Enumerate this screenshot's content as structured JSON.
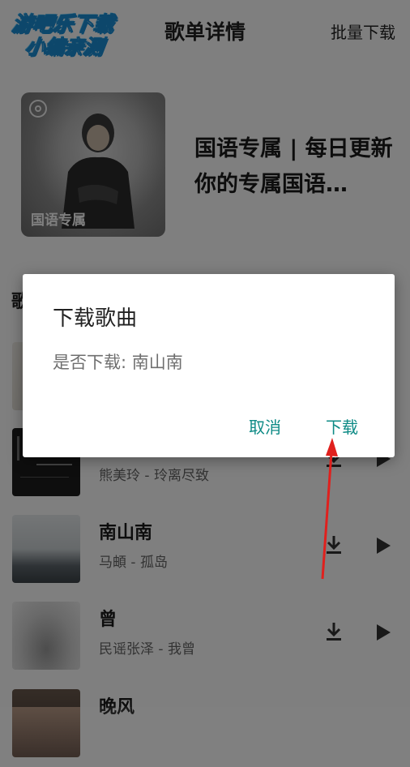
{
  "logo": {
    "line1": "游吧乐下载",
    "line2": "小编亲测"
  },
  "header": {
    "title": "歌单详情",
    "batch_download": "批量下载"
  },
  "playlist": {
    "cover_label": "国语专属",
    "title": "国语专属 | 每日更新 你的专属国语…"
  },
  "section": {
    "head": "歌"
  },
  "songs": [
    {
      "title": "",
      "subtitle": ""
    },
    {
      "title": "",
      "subtitle": "熊美玲 - 玲离尽致"
    },
    {
      "title": "南山南",
      "subtitle": "马頔 - 孤岛"
    },
    {
      "title": "曾",
      "subtitle": "民谣张泽 - 我曾"
    },
    {
      "title": "晚风",
      "subtitle": ""
    }
  ],
  "dialog": {
    "title": "下载歌曲",
    "message": "是否下载: 南山南",
    "cancel": "取消",
    "confirm": "下载"
  },
  "colors": {
    "accent": "#0f8b86",
    "arrow": "#e0201d",
    "overlay": "rgba(0,0,0,0.5)"
  }
}
